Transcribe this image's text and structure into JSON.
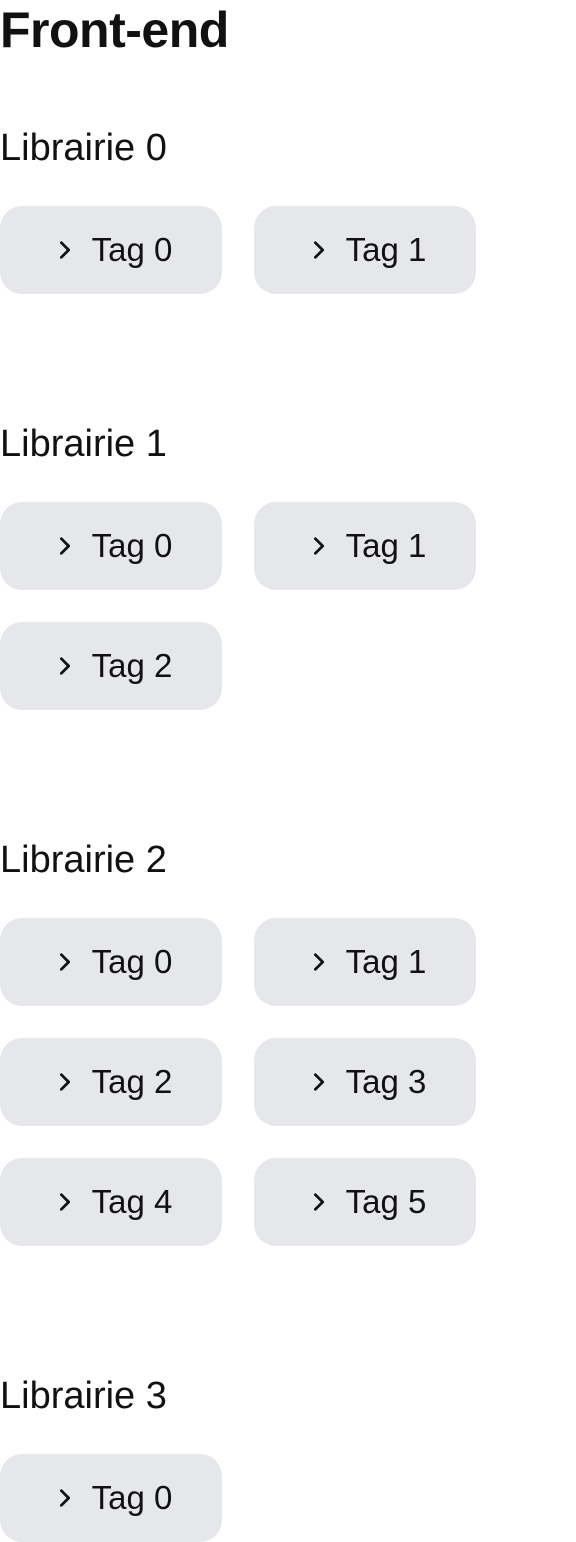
{
  "page": {
    "title": "Front-end",
    "colors": {
      "background": "#ffffff",
      "text": "#111111",
      "tag_background": "#e5e7eb"
    },
    "icon": "chevron-right-icon"
  },
  "libraries": [
    {
      "title": "Librairie 0",
      "tags": [
        "Tag 0",
        "Tag 1"
      ]
    },
    {
      "title": "Librairie 1",
      "tags": [
        "Tag 0",
        "Tag 1",
        "Tag 2"
      ]
    },
    {
      "title": "Librairie 2",
      "tags": [
        "Tag 0",
        "Tag 1",
        "Tag 2",
        "Tag 3",
        "Tag 4",
        "Tag 5"
      ]
    },
    {
      "title": "Librairie 3",
      "tags": [
        "Tag 0"
      ]
    }
  ]
}
